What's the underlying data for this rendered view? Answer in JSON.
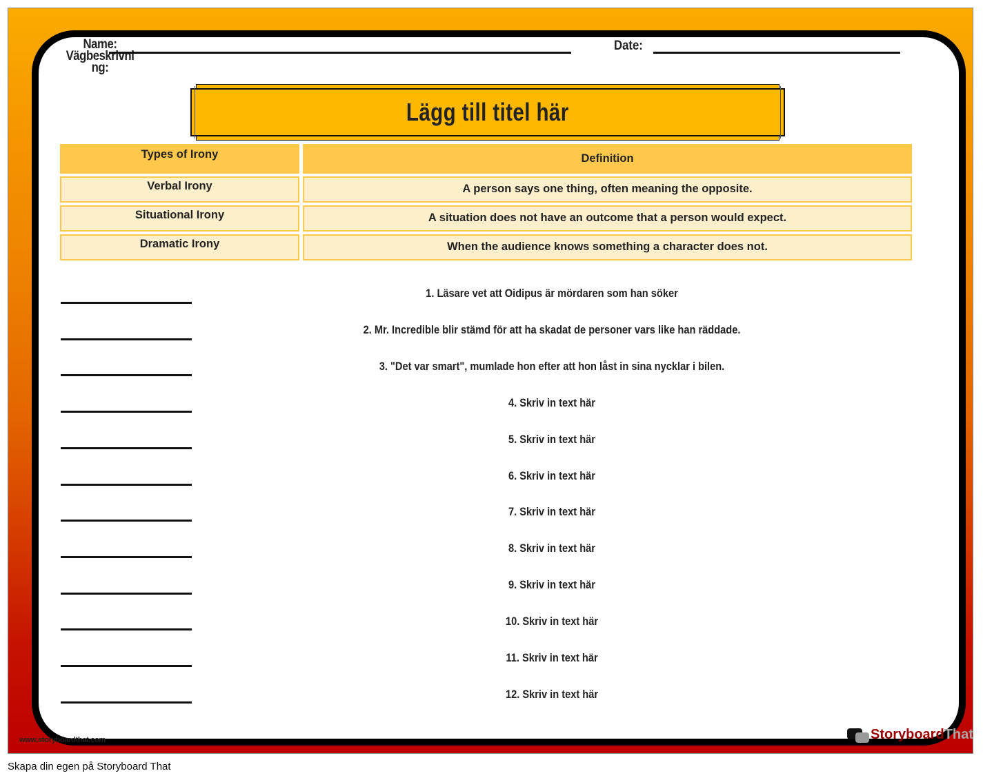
{
  "header": {
    "name_label": "Name:",
    "name_overlay_label": "Vägbeskrivning:",
    "date_label": "Date:"
  },
  "title": "Lägg till titel här",
  "table": {
    "headers": [
      "Types of Irony",
      "Definition"
    ],
    "rows": [
      {
        "type": "Verbal Irony",
        "definition": "A person says one thing, often meaning the opposite."
      },
      {
        "type": "Situational Irony",
        "definition": "A situation does not have an outcome that a person would expect."
      },
      {
        "type": "Dramatic Irony",
        "definition": "When the audience knows something a character does not."
      }
    ]
  },
  "prompts": [
    "1. Läsare vet att Oidipus är mördaren som han söker",
    "2. Mr. Incredible blir stämd för att ha skadat de personer vars like han räddade.",
    "3. \"Det var smart\", mumlade hon efter att hon låst in sina nycklar i bilen.",
    "4. Skriv in text här",
    "5. Skriv in text här",
    "6. Skriv in text här",
    "7. Skriv in text här",
    "8. Skriv in text här",
    "9. Skriv in text här",
    "10. Skriv in text här",
    "11. Skriv in text här",
    "12. Skriv in text här"
  ],
  "footer": {
    "site_url": "www.storyboardthat.com",
    "brand_storyboard": "Storyboard",
    "brand_that": "That",
    "create_link": "Skapa din egen på Storyboard That"
  },
  "colors": {
    "gradient_top": "#fcab00",
    "gradient_bottom": "#bd0000",
    "title_fill": "#fdb800",
    "table_header": "#ffc84a",
    "table_cell": "#feefcc"
  }
}
